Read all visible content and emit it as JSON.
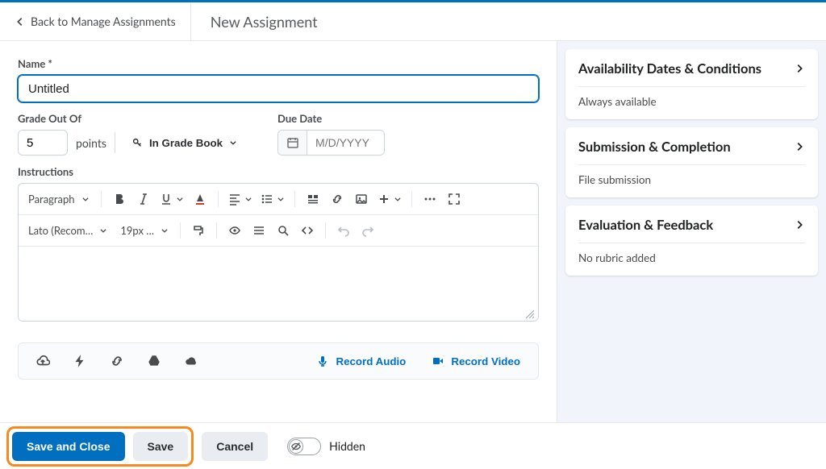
{
  "header": {
    "back_label": "Back to Manage Assignments",
    "page_title": "New Assignment"
  },
  "fields": {
    "name_label": "Name *",
    "name_value": "Untitled",
    "grade_label": "Grade Out Of",
    "grade_value": "5",
    "grade_unit": "points",
    "gradebook_btn": "In Grade Book",
    "due_label": "Due Date",
    "due_placeholder": "M/D/YYYY",
    "instructions_label": "Instructions"
  },
  "rte": {
    "block_select": "Paragraph",
    "font_select": "Lato (Recom…",
    "size_select": "19px …"
  },
  "media": {
    "record_audio": "Record Audio",
    "record_video": "Record Video"
  },
  "panels": {
    "availability": {
      "title": "Availability Dates & Conditions",
      "status": "Always available"
    },
    "submission": {
      "title": "Submission & Completion",
      "status": "File submission"
    },
    "evaluation": {
      "title": "Evaluation & Feedback",
      "status": "No rubric added"
    }
  },
  "footer": {
    "save_close": "Save and Close",
    "save": "Save",
    "cancel": "Cancel",
    "visibility": "Hidden"
  }
}
